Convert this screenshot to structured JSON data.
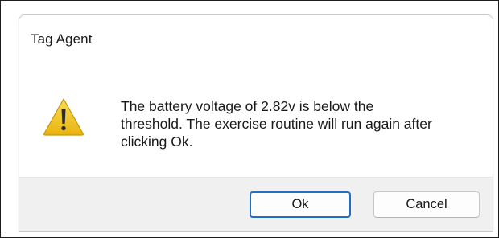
{
  "dialog": {
    "title": "Tag Agent",
    "icon": "warning-icon",
    "message_lines": [
      "The battery voltage of 2.82v is below the",
      "threshold. The exercise routine will run again after",
      "clicking Ok."
    ],
    "buttons": {
      "ok_label": "Ok",
      "cancel_label": "Cancel"
    }
  },
  "colors": {
    "accent_border": "#1f6fc7",
    "footer_bg": "#f0f0f0",
    "warning_fill": "#f3c623",
    "warning_mark": "#2b2b2b"
  }
}
